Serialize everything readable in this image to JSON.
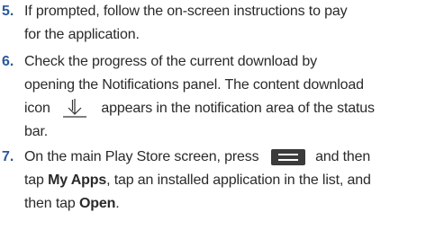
{
  "steps": [
    {
      "number": "5.",
      "lines": [
        "If prompted, follow the on-screen instructions to pay",
        "for the application."
      ]
    },
    {
      "number": "6.",
      "lines": [
        "Check the progress of the current download by",
        "opening the Notifications panel. The content download"
      ],
      "line3_prefix": "icon",
      "line3_suffix": "appears in the notification area of the status",
      "line4": "bar."
    },
    {
      "number": "7.",
      "line1_prefix": "On the main Play Store screen, press",
      "line1_suffix": "and then",
      "line2_pre": "tap",
      "line2_bold": "My Apps",
      "line2_post": ", tap an installed application in the list, and",
      "line3_pre": "then tap",
      "line3_bold": "Open",
      "line3_post": "."
    }
  ],
  "icons": {
    "download": "download-icon",
    "menu": "menu-icon"
  }
}
